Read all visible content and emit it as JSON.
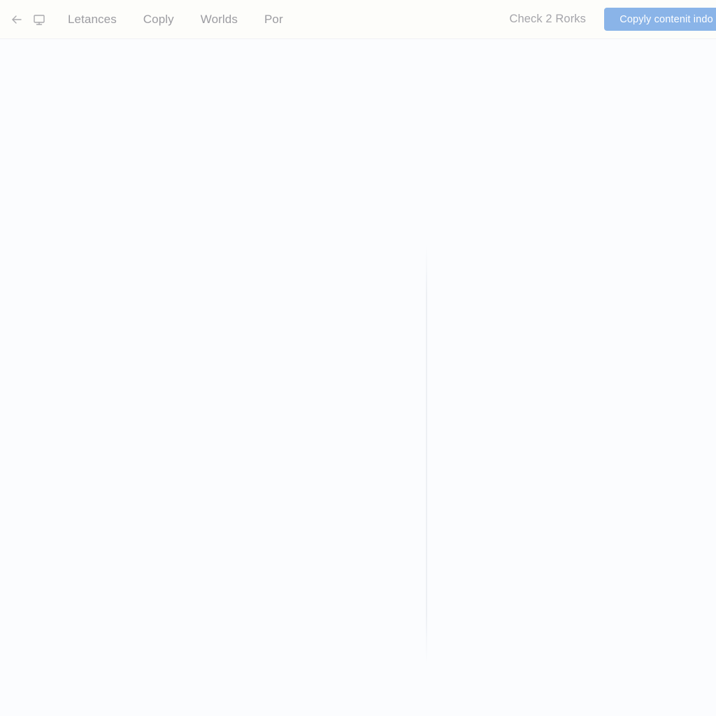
{
  "toolbar": {
    "back_icon": "arrow-left-icon",
    "display_icon": "monitor-icon",
    "nav_items": [
      {
        "label": "Letances"
      },
      {
        "label": "Coply"
      },
      {
        "label": "Worlds"
      },
      {
        "label": "Por"
      }
    ],
    "status_label": "Check 2 Rorks",
    "primary_button_label": "Copyly contenit indo",
    "colors": {
      "background": "#fdfdfa",
      "border": "#f1f1f4",
      "nav_text": "#9c9ca1",
      "status_text": "#a5a5aa",
      "icon": "#a9a9ad",
      "primary_button_bg": "#8ab4e8",
      "primary_button_text": "#ffffff"
    }
  },
  "content": {
    "background": "#fbfcfe",
    "divider_color": "#e2e6ec",
    "left_pane": {
      "body_text": ""
    },
    "right_pane": {
      "body_text": ""
    }
  }
}
